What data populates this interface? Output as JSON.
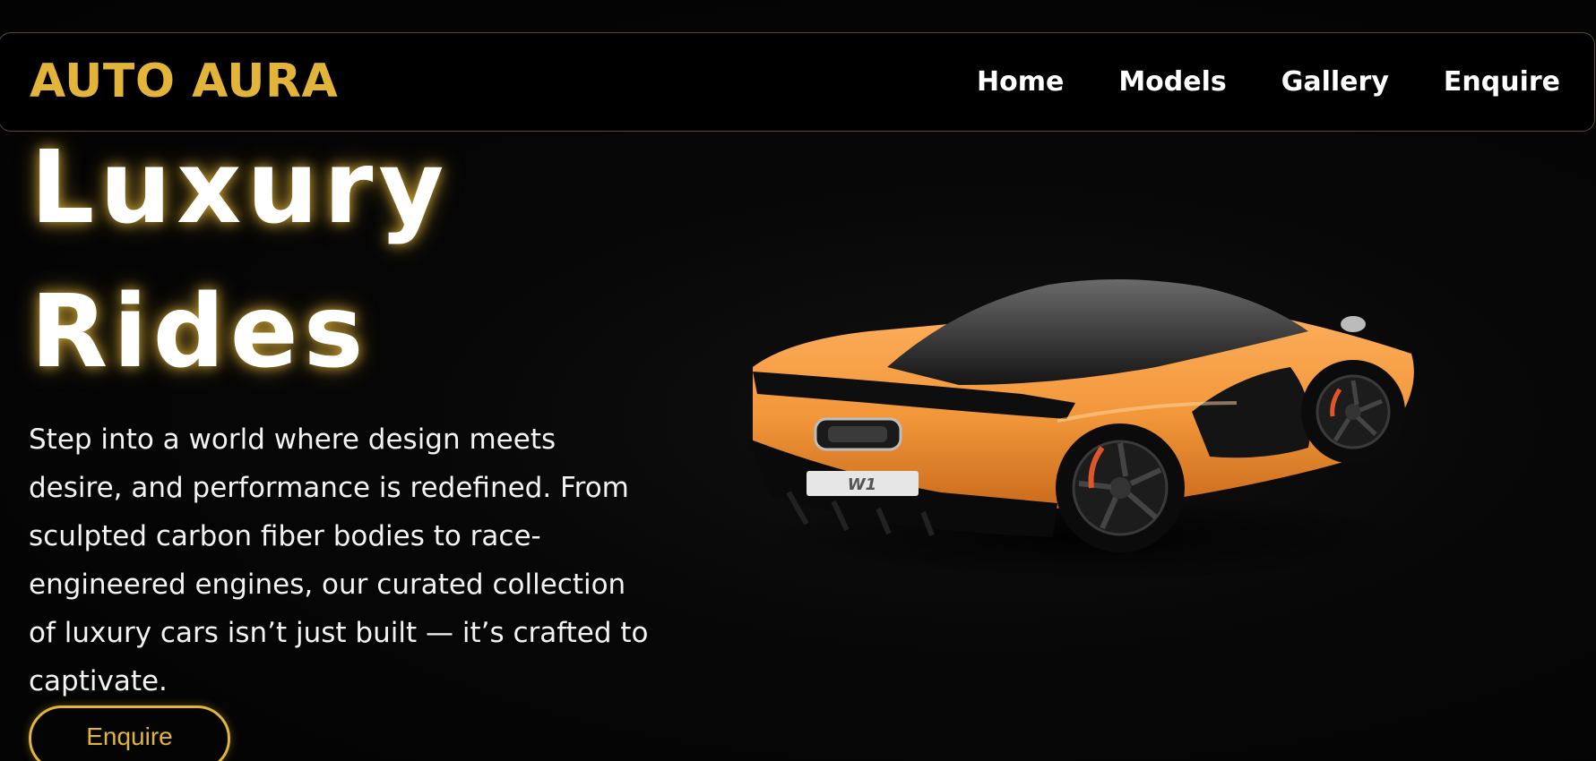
{
  "brand": {
    "name": "AUTO AURA",
    "color": "#e2b43a"
  },
  "nav": {
    "items": [
      {
        "label": "Home"
      },
      {
        "label": "Models"
      },
      {
        "label": "Gallery"
      },
      {
        "label": "Enquire"
      }
    ]
  },
  "hero": {
    "title_line1": "Luxury",
    "title_line2": "Rides",
    "description": "Step into a world where design meets desire, and performance is redefined. From sculpted carbon fiber bodies to race-engineered engines, our curated collection of luxury cars isn’t just built — it’s crafted to captivate.",
    "cta_label": "Enquire"
  },
  "car": {
    "plate_text": "W1",
    "body_color": "#f2973a",
    "trim_color": "#111111"
  }
}
